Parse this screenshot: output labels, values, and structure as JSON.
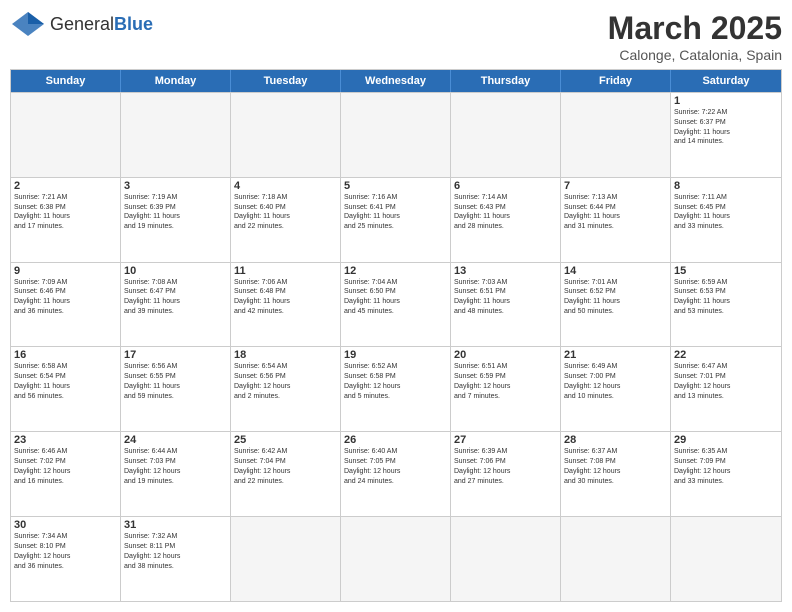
{
  "header": {
    "logo_general": "General",
    "logo_blue": "Blue",
    "month_title": "March 2025",
    "subtitle": "Calonge, Catalonia, Spain"
  },
  "day_headers": [
    "Sunday",
    "Monday",
    "Tuesday",
    "Wednesday",
    "Thursday",
    "Friday",
    "Saturday"
  ],
  "weeks": [
    {
      "days": [
        {
          "num": "",
          "empty": true
        },
        {
          "num": "",
          "empty": true
        },
        {
          "num": "",
          "empty": true
        },
        {
          "num": "",
          "empty": true
        },
        {
          "num": "",
          "empty": true
        },
        {
          "num": "",
          "empty": true
        },
        {
          "num": "1",
          "info": "Sunrise: 7:22 AM\nSunset: 6:37 PM\nDaylight: 11 hours\nand 14 minutes."
        }
      ]
    },
    {
      "days": [
        {
          "num": "2",
          "info": "Sunrise: 7:21 AM\nSunset: 6:38 PM\nDaylight: 11 hours\nand 17 minutes."
        },
        {
          "num": "3",
          "info": "Sunrise: 7:19 AM\nSunset: 6:39 PM\nDaylight: 11 hours\nand 19 minutes."
        },
        {
          "num": "4",
          "info": "Sunrise: 7:18 AM\nSunset: 6:40 PM\nDaylight: 11 hours\nand 22 minutes."
        },
        {
          "num": "5",
          "info": "Sunrise: 7:16 AM\nSunset: 6:41 PM\nDaylight: 11 hours\nand 25 minutes."
        },
        {
          "num": "6",
          "info": "Sunrise: 7:14 AM\nSunset: 6:43 PM\nDaylight: 11 hours\nand 28 minutes."
        },
        {
          "num": "7",
          "info": "Sunrise: 7:13 AM\nSunset: 6:44 PM\nDaylight: 11 hours\nand 31 minutes."
        },
        {
          "num": "8",
          "info": "Sunrise: 7:11 AM\nSunset: 6:45 PM\nDaylight: 11 hours\nand 33 minutes."
        }
      ]
    },
    {
      "days": [
        {
          "num": "9",
          "info": "Sunrise: 7:09 AM\nSunset: 6:46 PM\nDaylight: 11 hours\nand 36 minutes."
        },
        {
          "num": "10",
          "info": "Sunrise: 7:08 AM\nSunset: 6:47 PM\nDaylight: 11 hours\nand 39 minutes."
        },
        {
          "num": "11",
          "info": "Sunrise: 7:06 AM\nSunset: 6:48 PM\nDaylight: 11 hours\nand 42 minutes."
        },
        {
          "num": "12",
          "info": "Sunrise: 7:04 AM\nSunset: 6:50 PM\nDaylight: 11 hours\nand 45 minutes."
        },
        {
          "num": "13",
          "info": "Sunrise: 7:03 AM\nSunset: 6:51 PM\nDaylight: 11 hours\nand 48 minutes."
        },
        {
          "num": "14",
          "info": "Sunrise: 7:01 AM\nSunset: 6:52 PM\nDaylight: 11 hours\nand 50 minutes."
        },
        {
          "num": "15",
          "info": "Sunrise: 6:59 AM\nSunset: 6:53 PM\nDaylight: 11 hours\nand 53 minutes."
        }
      ]
    },
    {
      "days": [
        {
          "num": "16",
          "info": "Sunrise: 6:58 AM\nSunset: 6:54 PM\nDaylight: 11 hours\nand 56 minutes."
        },
        {
          "num": "17",
          "info": "Sunrise: 6:56 AM\nSunset: 6:55 PM\nDaylight: 11 hours\nand 59 minutes."
        },
        {
          "num": "18",
          "info": "Sunrise: 6:54 AM\nSunset: 6:56 PM\nDaylight: 12 hours\nand 2 minutes."
        },
        {
          "num": "19",
          "info": "Sunrise: 6:52 AM\nSunset: 6:58 PM\nDaylight: 12 hours\nand 5 minutes."
        },
        {
          "num": "20",
          "info": "Sunrise: 6:51 AM\nSunset: 6:59 PM\nDaylight: 12 hours\nand 7 minutes."
        },
        {
          "num": "21",
          "info": "Sunrise: 6:49 AM\nSunset: 7:00 PM\nDaylight: 12 hours\nand 10 minutes."
        },
        {
          "num": "22",
          "info": "Sunrise: 6:47 AM\nSunset: 7:01 PM\nDaylight: 12 hours\nand 13 minutes."
        }
      ]
    },
    {
      "days": [
        {
          "num": "23",
          "info": "Sunrise: 6:46 AM\nSunset: 7:02 PM\nDaylight: 12 hours\nand 16 minutes."
        },
        {
          "num": "24",
          "info": "Sunrise: 6:44 AM\nSunset: 7:03 PM\nDaylight: 12 hours\nand 19 minutes."
        },
        {
          "num": "25",
          "info": "Sunrise: 6:42 AM\nSunset: 7:04 PM\nDaylight: 12 hours\nand 22 minutes."
        },
        {
          "num": "26",
          "info": "Sunrise: 6:40 AM\nSunset: 7:05 PM\nDaylight: 12 hours\nand 24 minutes."
        },
        {
          "num": "27",
          "info": "Sunrise: 6:39 AM\nSunset: 7:06 PM\nDaylight: 12 hours\nand 27 minutes."
        },
        {
          "num": "28",
          "info": "Sunrise: 6:37 AM\nSunset: 7:08 PM\nDaylight: 12 hours\nand 30 minutes."
        },
        {
          "num": "29",
          "info": "Sunrise: 6:35 AM\nSunset: 7:09 PM\nDaylight: 12 hours\nand 33 minutes."
        }
      ]
    },
    {
      "days": [
        {
          "num": "30",
          "info": "Sunrise: 7:34 AM\nSunset: 8:10 PM\nDaylight: 12 hours\nand 36 minutes."
        },
        {
          "num": "31",
          "info": "Sunrise: 7:32 AM\nSunset: 8:11 PM\nDaylight: 12 hours\nand 38 minutes."
        },
        {
          "num": "",
          "empty": true
        },
        {
          "num": "",
          "empty": true
        },
        {
          "num": "",
          "empty": true
        },
        {
          "num": "",
          "empty": true
        },
        {
          "num": "",
          "empty": true
        }
      ]
    }
  ]
}
